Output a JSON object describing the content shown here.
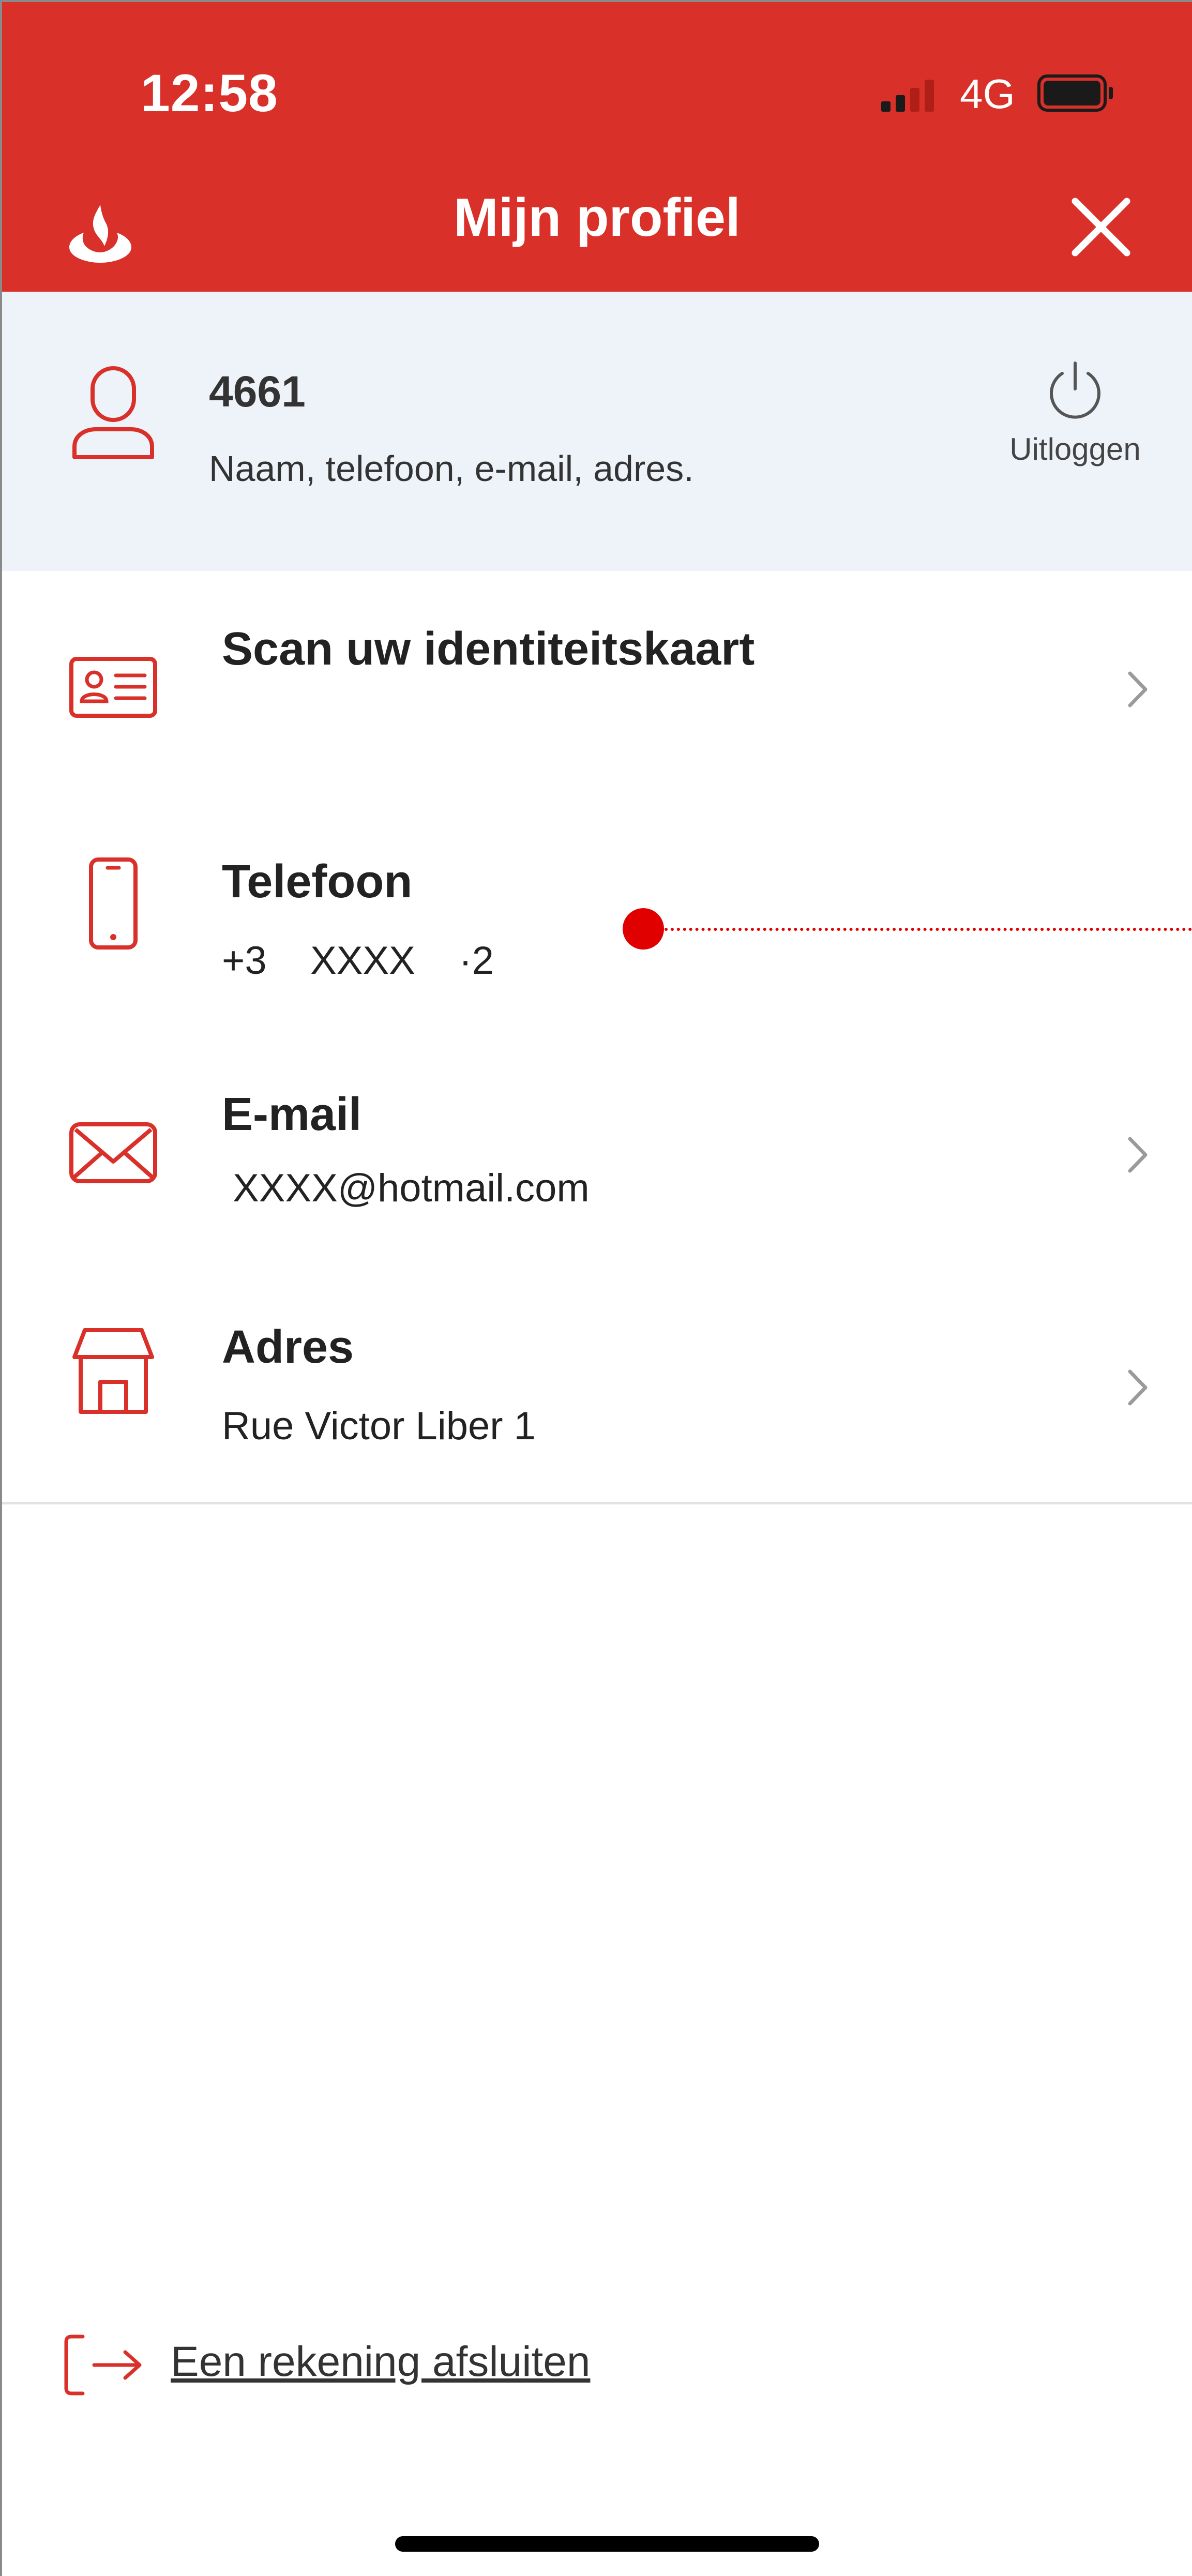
{
  "status_bar": {
    "time": "12:58",
    "network": "4G"
  },
  "header": {
    "title": "Mijn profiel"
  },
  "profile": {
    "id": "4661",
    "subtitle": "Naam, telefoon, e-mail, adres.",
    "logout_label": "Uitloggen"
  },
  "rows": [
    {
      "title": "Scan uw identiteitskaart",
      "value": ""
    },
    {
      "title": "Telefoon",
      "value": "+3    XXXX    ·2"
    },
    {
      "title": "E-mail",
      "value": " XXXX@hotmail.com"
    },
    {
      "title": "Adres",
      "value": "Rue Victor Liber 1"
    }
  ],
  "footer": {
    "close_account_label": "Een rekening afsluiten"
  },
  "colors": {
    "brand": "#d9312a",
    "profile_bg": "#eef3f9",
    "divider": "#e2e2e2",
    "annotation": "#e00000"
  },
  "icons": [
    "santander-logo-icon",
    "close-icon",
    "user-icon",
    "power-icon",
    "id-card-icon",
    "phone-icon",
    "mail-icon",
    "store-icon",
    "chevron-right-icon",
    "exit-arrow-icon"
  ]
}
